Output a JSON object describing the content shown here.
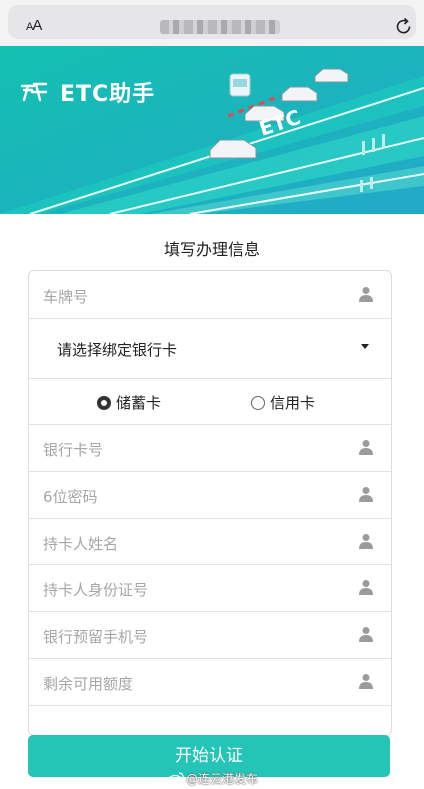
{
  "browser": {
    "text_size_label": "AA",
    "reload_icon": "reload-icon"
  },
  "banner": {
    "logo_text": "ETC助手",
    "road_text": "ETC"
  },
  "form": {
    "title": "填写办理信息",
    "plate_placeholder": "车牌号",
    "bank_select": "请选择绑定银行卡",
    "card_types": [
      "储蓄卡",
      "信用卡"
    ],
    "selected_card_type": "储蓄卡",
    "fields": [
      "银行卡号",
      "6位密码",
      "持卡人姓名",
      "持卡人身份证号",
      "银行预留手机号",
      "剩余可用额度"
    ],
    "field_icon": "user-icon",
    "submit_label": "开始认证"
  },
  "watermark": "@连云港发布",
  "colors": {
    "accent": "#24c4b6",
    "banner_from": "#17c2b4",
    "banner_to": "#1fb0c8"
  }
}
